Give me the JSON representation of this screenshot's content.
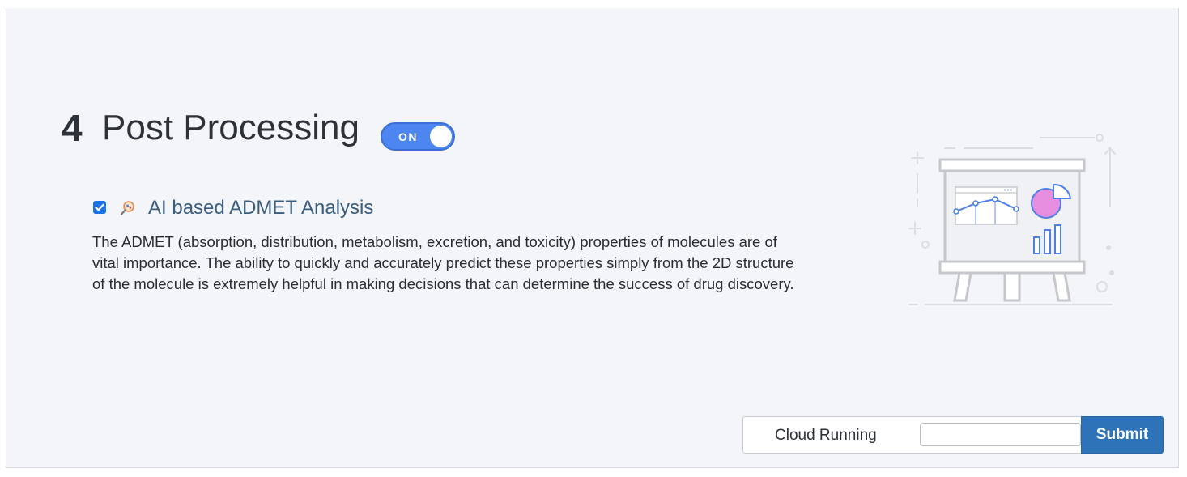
{
  "section": {
    "number": "4",
    "title": "Post Processing",
    "toggle_label": "ON",
    "toggle_on": true
  },
  "option": {
    "checked": true,
    "icon": "magnifier-molecule-icon",
    "title": "AI based ADMET Analysis",
    "description": "The ADMET (absorption, distribution, metabolism, excretion, and toxicity) properties of molecules are of vital importance. The ability to quickly and accurately predict these properties simply from the 2D structure of the molecule is extremely helpful in making decisions that can determine the success of drug discovery."
  },
  "illustration": {
    "icon": "presentation-board-chart-icon"
  },
  "footer": {
    "cloud_label": "Cloud Running",
    "input_value": "",
    "input_placeholder": "",
    "submit_label": "Submit"
  },
  "colors": {
    "accent": "#4d86f0",
    "submit": "#2e72b8",
    "title": "#3b5d7e",
    "background": "#f4f5f9"
  }
}
